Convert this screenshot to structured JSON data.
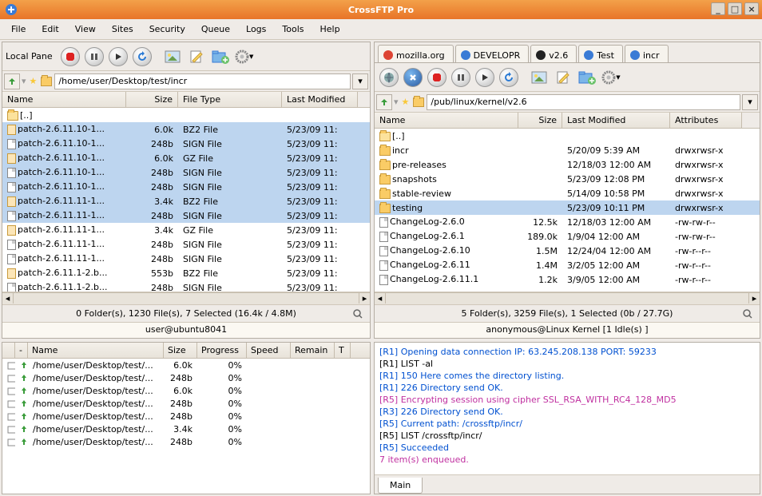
{
  "title": "CrossFTP Pro",
  "menu": [
    "File",
    "Edit",
    "View",
    "Sites",
    "Security",
    "Queue",
    "Logs",
    "Tools",
    "Help"
  ],
  "left": {
    "label": "Local Pane",
    "path": "/home/user/Desktop/test/incr",
    "cols": [
      "Name",
      "Size",
      "File Type",
      "Last Modified"
    ],
    "rows": [
      {
        "icon": "fold open",
        "name": "[..]",
        "size": "",
        "type": "",
        "mod": "",
        "sel": false
      },
      {
        "icon": "arch",
        "name": "patch-2.6.11.10-1...",
        "size": "6.0k",
        "type": "BZ2 File",
        "mod": "5/23/09 11:",
        "sel": true
      },
      {
        "icon": "fil",
        "name": "patch-2.6.11.10-1...",
        "size": "248b",
        "type": "SIGN File",
        "mod": "5/23/09 11:",
        "sel": true
      },
      {
        "icon": "arch",
        "name": "patch-2.6.11.10-1...",
        "size": "6.0k",
        "type": "GZ File",
        "mod": "5/23/09 11:",
        "sel": true
      },
      {
        "icon": "fil",
        "name": "patch-2.6.11.10-1...",
        "size": "248b",
        "type": "SIGN File",
        "mod": "5/23/09 11:",
        "sel": true
      },
      {
        "icon": "fil",
        "name": "patch-2.6.11.10-1...",
        "size": "248b",
        "type": "SIGN File",
        "mod": "5/23/09 11:",
        "sel": true
      },
      {
        "icon": "arch",
        "name": "patch-2.6.11.11-1...",
        "size": "3.4k",
        "type": "BZ2 File",
        "mod": "5/23/09 11:",
        "sel": true
      },
      {
        "icon": "fil",
        "name": "patch-2.6.11.11-1...",
        "size": "248b",
        "type": "SIGN File",
        "mod": "5/23/09 11:",
        "sel": true
      },
      {
        "icon": "arch",
        "name": "patch-2.6.11.11-1...",
        "size": "3.4k",
        "type": "GZ File",
        "mod": "5/23/09 11:",
        "sel": false
      },
      {
        "icon": "fil",
        "name": "patch-2.6.11.11-1...",
        "size": "248b",
        "type": "SIGN File",
        "mod": "5/23/09 11:",
        "sel": false
      },
      {
        "icon": "fil",
        "name": "patch-2.6.11.11-1...",
        "size": "248b",
        "type": "SIGN File",
        "mod": "5/23/09 11:",
        "sel": false
      },
      {
        "icon": "arch",
        "name": "patch-2.6.11.1-2.b...",
        "size": "553b",
        "type": "BZ2 File",
        "mod": "5/23/09 11:",
        "sel": false
      },
      {
        "icon": "fil",
        "name": "patch-2.6.11.1-2.b...",
        "size": "248b",
        "type": "SIGN File",
        "mod": "5/23/09 11:",
        "sel": false
      }
    ],
    "status": "0 Folder(s), 1230 File(s), 7 Selected (16.4k / 4.8M)",
    "user": "user@ubuntu8041"
  },
  "right": {
    "tabs": [
      {
        "name": "mozilla.org",
        "color": "#d43"
      },
      {
        "name": "DEVELOPR",
        "color": "#3a7bd5"
      },
      {
        "name": "v2.6",
        "color": "#222"
      },
      {
        "name": "Test",
        "color": "#3a7bd5"
      },
      {
        "name": "incr",
        "color": "#3a7bd5"
      }
    ],
    "path": "/pub/linux/kernel/v2.6",
    "cols": [
      "Name",
      "Size",
      "Last Modified",
      "Attributes"
    ],
    "rows": [
      {
        "icon": "fold open",
        "name": "[..]",
        "size": "",
        "mod": "",
        "attr": "",
        "sel": false
      },
      {
        "icon": "fold",
        "name": "incr",
        "size": "",
        "mod": "5/20/09 5:39 AM",
        "attr": "drwxrwsr-x",
        "sel": false
      },
      {
        "icon": "fold",
        "name": "pre-releases",
        "size": "",
        "mod": "12/18/03 12:00 AM",
        "attr": "drwxrwsr-x",
        "sel": false
      },
      {
        "icon": "fold",
        "name": "snapshots",
        "size": "",
        "mod": "5/23/09 12:08 PM",
        "attr": "drwxrwsr-x",
        "sel": false
      },
      {
        "icon": "fold",
        "name": "stable-review",
        "size": "",
        "mod": "5/14/09 10:58 PM",
        "attr": "drwxrwsr-x",
        "sel": false
      },
      {
        "icon": "fold",
        "name": "testing",
        "size": "",
        "mod": "5/23/09 10:11 PM",
        "attr": "drwxrwsr-x",
        "sel": true
      },
      {
        "icon": "fil",
        "name": "ChangeLog-2.6.0",
        "size": "12.5k",
        "mod": "12/18/03 12:00 AM",
        "attr": "-rw-rw-r--",
        "sel": false
      },
      {
        "icon": "fil",
        "name": "ChangeLog-2.6.1",
        "size": "189.0k",
        "mod": "1/9/04 12:00 AM",
        "attr": "-rw-rw-r--",
        "sel": false
      },
      {
        "icon": "fil",
        "name": "ChangeLog-2.6.10",
        "size": "1.5M",
        "mod": "12/24/04 12:00 AM",
        "attr": "-rw-r--r--",
        "sel": false
      },
      {
        "icon": "fil",
        "name": "ChangeLog-2.6.11",
        "size": "1.4M",
        "mod": "3/2/05 12:00 AM",
        "attr": "-rw-r--r--",
        "sel": false
      },
      {
        "icon": "fil",
        "name": "ChangeLog-2.6.11.1",
        "size": "1.2k",
        "mod": "3/9/05 12:00 AM",
        "attr": "-rw-r--r--",
        "sel": false
      }
    ],
    "status": "5 Folder(s), 3259 File(s), 1 Selected (0b / 27.7G)",
    "user": "anonymous@Linux Kernel [1 Idle(s) ]"
  },
  "queue": {
    "cols": [
      "",
      "-",
      "Name",
      "Size",
      "Progress",
      "Speed",
      "Remain",
      "T"
    ],
    "rows": [
      {
        "name": "/home/user/Desktop/test/...",
        "size": "6.0k",
        "prog": "0%"
      },
      {
        "name": "/home/user/Desktop/test/...",
        "size": "248b",
        "prog": "0%"
      },
      {
        "name": "/home/user/Desktop/test/...",
        "size": "6.0k",
        "prog": "0%"
      },
      {
        "name": "/home/user/Desktop/test/...",
        "size": "248b",
        "prog": "0%"
      },
      {
        "name": "/home/user/Desktop/test/...",
        "size": "248b",
        "prog": "0%"
      },
      {
        "name": "/home/user/Desktop/test/...",
        "size": "3.4k",
        "prog": "0%"
      },
      {
        "name": "/home/user/Desktop/test/...",
        "size": "248b",
        "prog": "0%"
      }
    ]
  },
  "log": {
    "lines": [
      {
        "t": "[R1] Opening data connection IP: 63.245.208.138 PORT: 59233",
        "c": "#0050d0"
      },
      {
        "t": "[R1] LIST -al",
        "c": "#000"
      },
      {
        "t": "[R1] 150 Here comes the directory listing.",
        "c": "#0050d0"
      },
      {
        "t": "[R1] 226 Directory send OK.",
        "c": "#0050d0"
      },
      {
        "t": "[R5] Encrypting session using cipher SSL_RSA_WITH_RC4_128_MD5",
        "c": "#c030a0"
      },
      {
        "t": "[R3] 226 Directory send OK.",
        "c": "#0050d0"
      },
      {
        "t": "[R5] Current path: /crossftp/incr/",
        "c": "#0050d0"
      },
      {
        "t": "[R5] LIST /crossftp/incr/",
        "c": "#000"
      },
      {
        "t": "[R5] Succeeded",
        "c": "#0050d0"
      },
      {
        "t": "7 item(s) enqueued.",
        "c": "#c030a0"
      }
    ],
    "tab": "Main"
  }
}
